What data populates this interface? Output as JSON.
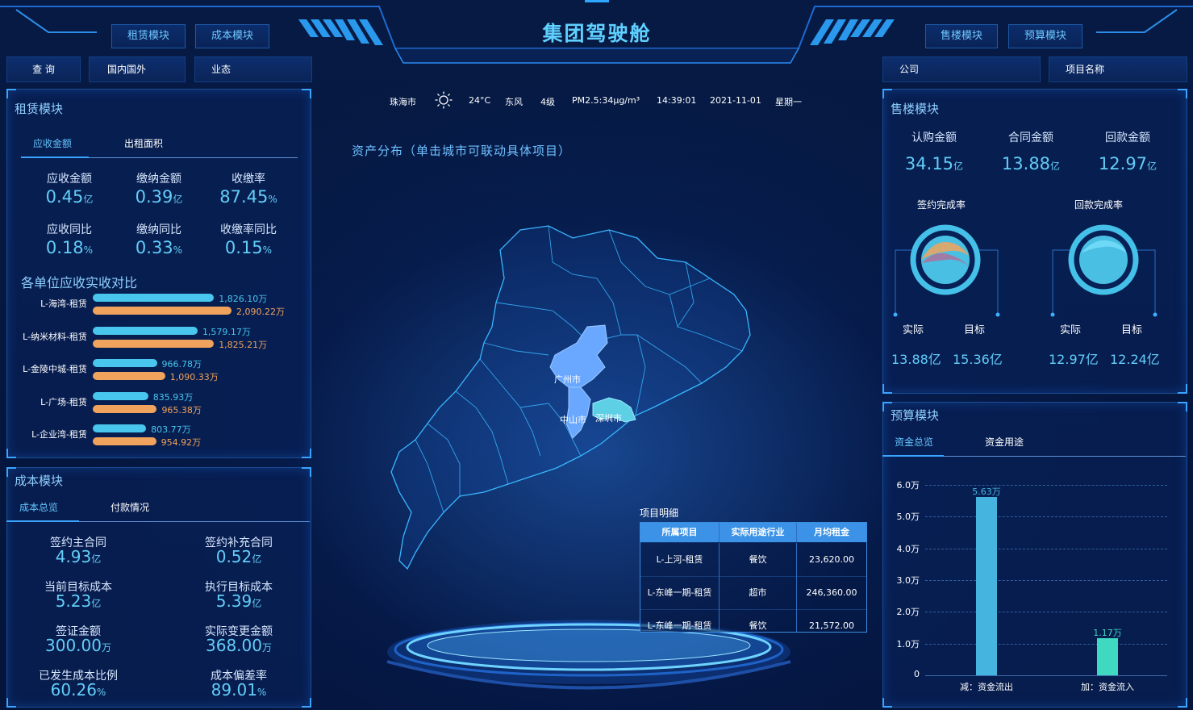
{
  "header": {
    "title": "集团驾驶舱",
    "left_modules": [
      "租赁模块",
      "成本模块"
    ],
    "right_modules": [
      "售楼模块",
      "预算模块"
    ]
  },
  "filters_left": [
    "查 询",
    "国内国外",
    "业态"
  ],
  "filters_right": [
    "公司",
    "项目名称"
  ],
  "weather": {
    "city": "珠海市",
    "temp": "24°C",
    "wind_dir": "东风",
    "wind_level": "4级",
    "pm": "PM2.5:34μg/m³",
    "time": "14:39:01",
    "date": "2021-11-01",
    "weekday": "星期一"
  },
  "map": {
    "title": "资产分布（单击城市可联动具体项目）",
    "cities": [
      "广州市",
      "中山市",
      "深圳市"
    ],
    "highlight_color": "#6aa8ff",
    "highlight_color_2": "#5dd0e6"
  },
  "project_detail": {
    "title": "项目明细",
    "columns": [
      "所属项目",
      "实际用途行业",
      "月均租金"
    ],
    "rows": [
      [
        "L-上河-租赁",
        "餐饮",
        "23,620.00"
      ],
      [
        "L-东峰一期-租赁",
        "超市",
        "246,360.00"
      ],
      [
        "L-东峰一期-租赁",
        "餐饮",
        "21,572.00"
      ]
    ]
  },
  "rental": {
    "title": "租赁模块",
    "tabs": [
      "应收金额",
      "出租面积"
    ],
    "kpis": [
      {
        "label": "应收金额",
        "value": "0.45",
        "unit": "亿"
      },
      {
        "label": "缴纳金额",
        "value": "0.39",
        "unit": "亿"
      },
      {
        "label": "收缴率",
        "value": "87.45",
        "unit": "%"
      },
      {
        "label": "应收同比",
        "value": "0.18",
        "unit": "%"
      },
      {
        "label": "缴纳同比",
        "value": "0.33",
        "unit": "%"
      },
      {
        "label": "收缴率同比",
        "value": "0.15",
        "unit": "%"
      }
    ],
    "compare_title": "各单位应收实收对比",
    "bars": [
      {
        "name": "L-海湾-租赁",
        "a": 1826.1,
        "a_label": "1,826.10万",
        "b": 2090.22,
        "b_label": "2,090.22万"
      },
      {
        "name": "L-纳米材料-租赁",
        "a": 1579.17,
        "a_label": "1,579.17万",
        "b": 1825.21,
        "b_label": "1,825.21万"
      },
      {
        "name": "L-金陵中城-租赁",
        "a": 966.78,
        "a_label": "966.78万",
        "b": 1090.33,
        "b_label": "1,090.33万"
      },
      {
        "name": "L-广场-租赁",
        "a": 835.93,
        "a_label": "835.93万",
        "b": 965.38,
        "b_label": "965.38万"
      },
      {
        "name": "L-企业湾-租赁",
        "a": 803.77,
        "a_label": "803.77万",
        "b": 954.92,
        "b_label": "954.92万"
      }
    ],
    "colors": {
      "a": "#48c6ee",
      "b": "#f0a35c"
    }
  },
  "cost": {
    "title": "成本模块",
    "tabs": [
      "成本总览",
      "付款情况"
    ],
    "kpis": [
      {
        "label": "签约主合同",
        "value": "4.93",
        "unit": "亿"
      },
      {
        "label": "签约补充合同",
        "value": "0.52",
        "unit": "亿"
      },
      {
        "label": "当前目标成本",
        "value": "5.23",
        "unit": "亿"
      },
      {
        "label": "执行目标成本",
        "value": "5.39",
        "unit": "亿"
      },
      {
        "label": "签证金额",
        "value": "300.00",
        "unit": "万"
      },
      {
        "label": "实际变更金额",
        "value": "368.00",
        "unit": "万"
      },
      {
        "label": "已发生成本比例",
        "value": "60.26",
        "unit": "%"
      },
      {
        "label": "成本偏差率",
        "value": "89.01",
        "unit": "%"
      }
    ]
  },
  "sales": {
    "title": "售楼模块",
    "kpis": [
      {
        "label": "认购金额",
        "value": "34.15",
        "unit": "亿"
      },
      {
        "label": "合同金额",
        "value": "13.88",
        "unit": "亿"
      },
      {
        "label": "回款金额",
        "value": "12.97",
        "unit": "亿"
      }
    ],
    "gauges": [
      {
        "title": "签约完成率",
        "actual_label": "实际",
        "target_label": "目标",
        "actual": "13.88亿",
        "target": "15.36亿"
      },
      {
        "title": "回款完成率",
        "actual_label": "实际",
        "target_label": "目标",
        "actual": "12.97亿",
        "target": "12.24亿"
      }
    ]
  },
  "budget": {
    "title": "预算模块",
    "tabs": [
      "资金总览",
      "资金用途"
    ]
  },
  "chart_data": {
    "type": "bar",
    "categories": [
      "减：资金流出",
      "加：资金流入"
    ],
    "values": [
      5.63,
      1.17
    ],
    "value_labels": [
      "5.63万",
      "1.17万"
    ],
    "y_ticks": [
      "0",
      "1.0万",
      "2.0万",
      "3.0万",
      "4.0万",
      "5.0万",
      "6.0万"
    ],
    "ylim": [
      0,
      6.0
    ],
    "colors": [
      "#45b5df",
      "#3fd9c1"
    ],
    "grid": true
  }
}
